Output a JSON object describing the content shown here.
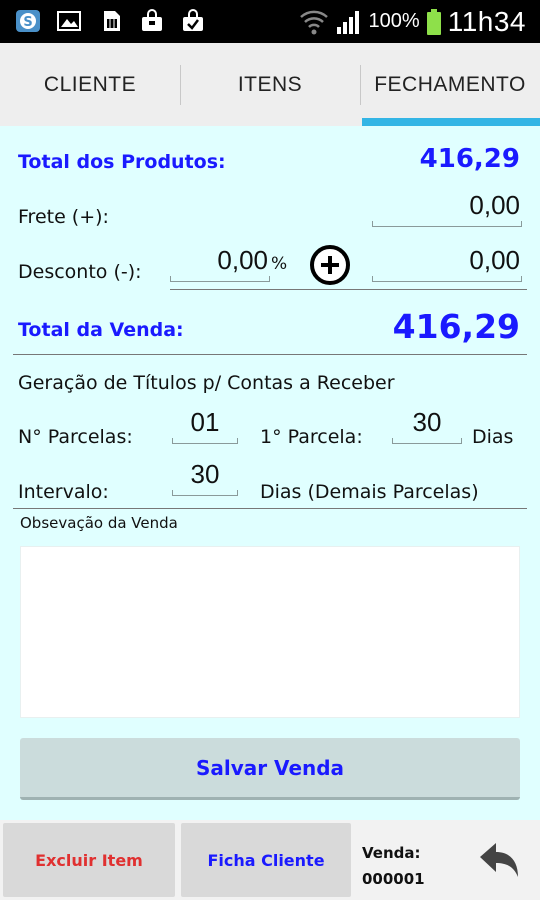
{
  "status_bar": {
    "battery": "100%",
    "time": "11h34",
    "left_icons": [
      "skype-icon",
      "image-icon",
      "sim-icon",
      "bag-icon",
      "bag-check-icon"
    ],
    "right_icons": [
      "wifi-icon",
      "signal-icon",
      "battery-icon"
    ]
  },
  "tabs": [
    {
      "label": "CLIENTE",
      "active": false
    },
    {
      "label": "ITENS",
      "active": false
    },
    {
      "label": "FECHAMENTO",
      "active": true
    }
  ],
  "form": {
    "total_produtos_label": "Total dos Produtos:",
    "total_produtos_value": "416,29",
    "frete_label": "Frete (+):",
    "frete_value": "0,00",
    "desconto_label": "Desconto (-):",
    "desconto_percent": "0,00",
    "percent_sign": "%",
    "desconto_value": "0,00",
    "total_venda_label": "Total da Venda:",
    "total_venda_value": "416,29",
    "titulos_heading": "Geração de Títulos p/ Contas a Receber",
    "parcelas_label": "N° Parcelas:",
    "parcelas_value": "01",
    "primeira_parcela_label": "1° Parcela:",
    "primeira_parcela_value": "30",
    "dias_label": "Dias",
    "intervalo_label": "Intervalo:",
    "intervalo_value": "30",
    "dias_demais_label": "Dias (Demais Parcelas)",
    "observacao_label": "Obsevação da Venda",
    "observacao_value": "",
    "save_button": "Salvar Venda"
  },
  "bottom_bar": {
    "excluir_item": "Excluir Item",
    "ficha_cliente": "Ficha Cliente",
    "venda_label": "Venda:",
    "venda_number": "000001"
  },
  "colors": {
    "accent": "#33b5e5",
    "blue_text": "#1a1aff",
    "background": "#e0ffff",
    "danger_text": "#e03030"
  }
}
